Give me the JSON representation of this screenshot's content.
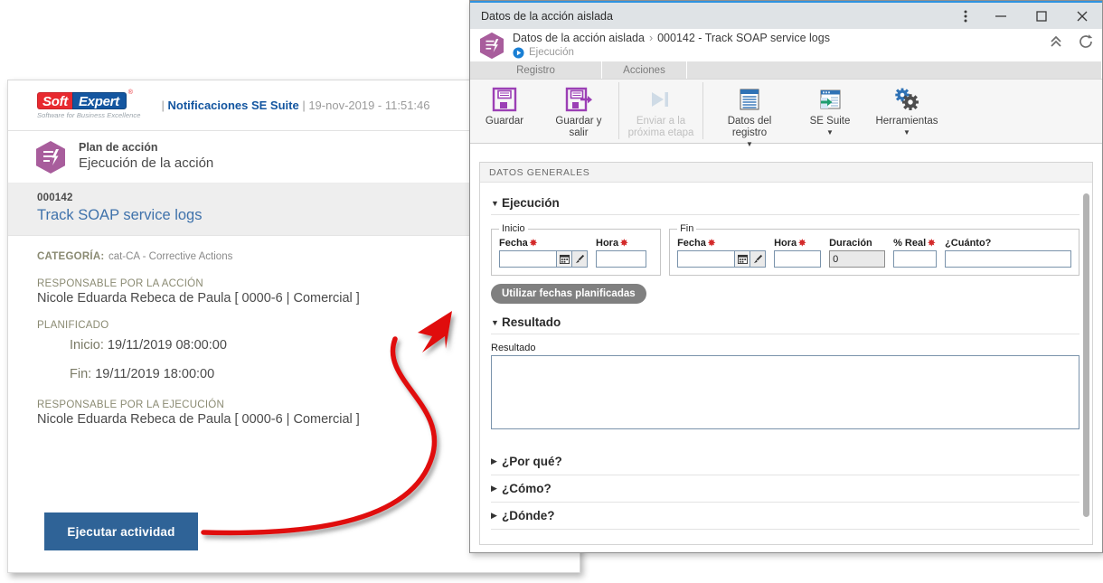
{
  "email": {
    "logo": {
      "part1": "Soft",
      "part2": "Expert",
      "registered": "®",
      "tagline": "Software for Business Excellence"
    },
    "header_title_prefix": "| ",
    "header_title_bold": "Notificaciones SE Suite",
    "header_title_suffix": " | 19-nov-2019 - 11:51:46",
    "plan_label": "Plan de acción",
    "plan_sub": "Ejecución de la acción",
    "record_id": "000142",
    "record_subject": "Track SOAP service logs",
    "category_label": "CATEGORÍA:",
    "category_value": "cat-CA - Corrective Actions",
    "responsible_action_label": "RESPONSABLE POR LA ACCIÓN",
    "responsible_action_value": "Nicole Eduarda Rebeca de Paula [ 0000-6 | Comercial ]",
    "planned_label": "PLANIFICADO",
    "planned_start_label": "Inicio:",
    "planned_start_value": "19/11/2019 08:00:00",
    "planned_end_label": "Fin:",
    "planned_end_value": "19/11/2019 18:00:00",
    "responsible_exec_label": "RESPONSABLE POR LA EJECUCIÓN",
    "responsible_exec_value": "Nicole Eduarda Rebeca de Paula [ 0000-6 | Comercial ]",
    "execute_button": "Ejecutar actividad",
    "button_color": "#2f6397",
    "link_color": "#3f72ab"
  },
  "annotation": {
    "arrow_color": "#e01010"
  },
  "window": {
    "title": "Datos de la acción aislada",
    "titlebar_accent": "#2f93e0",
    "menu_icon": "kebab-menu-icon",
    "minimize_icon": "minimize-icon",
    "maximize_icon": "maximize-icon",
    "close_icon": "close-icon",
    "breadcrumb": {
      "root": "Datos de la acción aislada",
      "separator": "›",
      "current": "000142 - Track SOAP service logs",
      "stage": "Ejecución",
      "collapse_icon": "chevron-double-up-icon",
      "refresh_icon": "refresh-icon"
    },
    "tabs": [
      {
        "label": "Registro",
        "active": true
      },
      {
        "label": "Acciones",
        "active": false
      }
    ],
    "ribbon": [
      {
        "label": "Guardar",
        "icon": "save-icon",
        "disabled": false,
        "caret": false
      },
      {
        "label": "Guardar y salir",
        "icon": "save-and-exit-icon",
        "disabled": false,
        "caret": false
      },
      {
        "label": "Enviar a la próxima etapa",
        "icon": "next-stage-icon",
        "disabled": true,
        "caret": false
      },
      {
        "label": "Datos del registro",
        "icon": "record-data-icon",
        "disabled": false,
        "caret": true
      },
      {
        "label": "SE Suite",
        "icon": "se-suite-icon",
        "disabled": false,
        "caret": true
      },
      {
        "label": "Herramientas",
        "icon": "gears-icon",
        "disabled": false,
        "caret": true
      }
    ],
    "section_bar": "DATOS GENERALES",
    "sections": {
      "execution": {
        "title": "Ejecución",
        "expanded": true,
        "start_group": "Inicio",
        "end_group": "Fin",
        "start_date_label": "Fecha",
        "start_date_value": "",
        "start_time_label": "Hora",
        "start_time_value": "",
        "end_date_label": "Fecha",
        "end_date_value": "",
        "end_time_label": "Hora",
        "end_time_value": "",
        "duration_label": "Duración",
        "duration_value": "0",
        "real_pct_label": "% Real",
        "real_pct_value": "",
        "how_much_label": "¿Cuánto?",
        "how_much_value": "",
        "calendar_icon": "calendar-icon",
        "clear_icon": "brush-clear-icon",
        "planned_dates_button": "Utilizar fechas planificadas"
      },
      "result": {
        "title": "Resultado",
        "expanded": true,
        "field_label": "Resultado",
        "field_value": ""
      },
      "collapsed": [
        {
          "title": "¿Por qué?"
        },
        {
          "title": "¿Cómo?"
        },
        {
          "title": "¿Dónde?"
        }
      ]
    }
  }
}
